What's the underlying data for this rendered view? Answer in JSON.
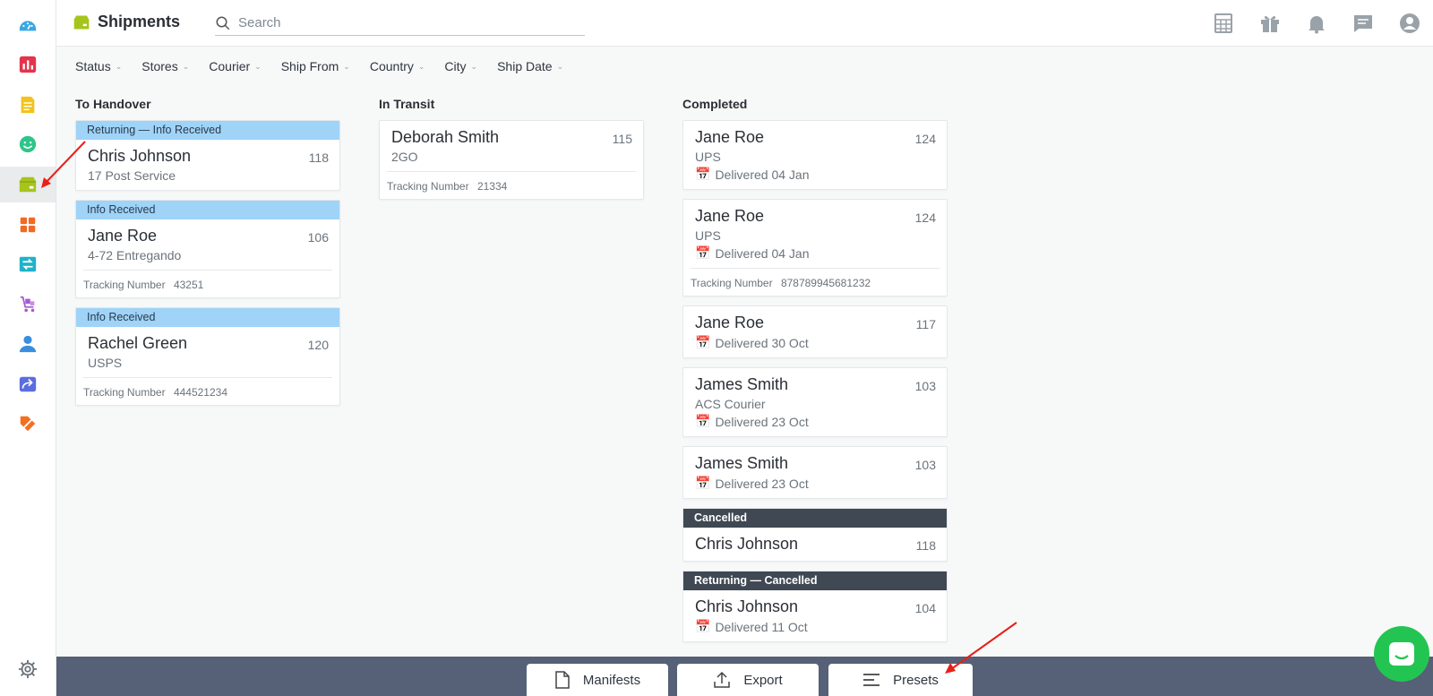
{
  "app": {
    "title": "Shipments",
    "search_placeholder": "Search"
  },
  "sidebar": {
    "items": [
      {
        "icon": "dashboard-icon",
        "color": "#3aa7e3"
      },
      {
        "icon": "reports-icon",
        "color": "#e3344d"
      },
      {
        "icon": "orders-icon",
        "color": "#f3c21b"
      },
      {
        "icon": "customers-icon",
        "color": "#2fc58a"
      },
      {
        "icon": "shipments-icon",
        "color": "#a5c51c"
      },
      {
        "icon": "apps-icon",
        "color": "#f26a21"
      },
      {
        "icon": "transfer-icon",
        "color": "#1fb3c9"
      },
      {
        "icon": "cart-icon",
        "color": "#a65ccf"
      },
      {
        "icon": "user-icon",
        "color": "#3a8ee0"
      },
      {
        "icon": "forward-icon",
        "color": "#5b6ee0"
      },
      {
        "icon": "tag-icon",
        "color": "#f37021"
      }
    ],
    "settings_icon": "gear-icon"
  },
  "header_icons": [
    "calculator-icon",
    "gift-icon",
    "bell-icon",
    "chat-icon",
    "account-icon"
  ],
  "filters": [
    "Status",
    "Stores",
    "Courier",
    "Ship From",
    "Country",
    "City",
    "Ship Date"
  ],
  "columns": {
    "handover": {
      "title": "To Handover",
      "cards": [
        {
          "tag": "Returning — Info Received",
          "name": "Chris Johnson",
          "num": "118",
          "sub": "17 Post Service"
        },
        {
          "tag": "Info Received",
          "name": "Jane Roe",
          "num": "106",
          "sub": "4-72 Entregando",
          "tracking_label": "Tracking Number",
          "tracking": "43251"
        },
        {
          "tag": "Info Received",
          "name": "Rachel Green",
          "num": "120",
          "sub": "USPS",
          "tracking_label": "Tracking Number",
          "tracking": "444521234"
        }
      ]
    },
    "transit": {
      "title": "In Transit",
      "cards": [
        {
          "name": "Deborah Smith",
          "num": "115",
          "sub": "2GO",
          "tracking_label": "Tracking Number",
          "tracking": "21334"
        }
      ]
    },
    "completed": {
      "title": "Completed",
      "cards": [
        {
          "name": "Jane Roe",
          "num": "124",
          "sub": "UPS",
          "date": "Delivered 04 Jan"
        },
        {
          "name": "Jane Roe",
          "num": "124",
          "sub": "UPS",
          "date": "Delivered 04 Jan",
          "tracking_label": "Tracking Number",
          "tracking": "878789945681232"
        },
        {
          "name": "Jane Roe",
          "num": "117",
          "date": "Delivered 30 Oct"
        },
        {
          "name": "James Smith",
          "num": "103",
          "sub": "ACS Courier",
          "date": "Delivered 23 Oct"
        },
        {
          "name": "James Smith",
          "num": "103",
          "date": "Delivered 23 Oct"
        },
        {
          "tag": "Cancelled",
          "name": "Chris Johnson",
          "num": "118"
        },
        {
          "tag": "Returning — Cancelled",
          "name": "Chris Johnson",
          "num": "104",
          "date": "Delivered 11 Oct"
        }
      ]
    }
  },
  "bottom": {
    "manifests": "Manifests",
    "export": "Export",
    "presets": "Presets"
  },
  "colors": {
    "tag_light": "#9fd3f8",
    "tag_dark": "#3f4853",
    "bottom_bar": "#566076",
    "annotation_arrow": "#e8201a",
    "chat": "#23c552"
  }
}
